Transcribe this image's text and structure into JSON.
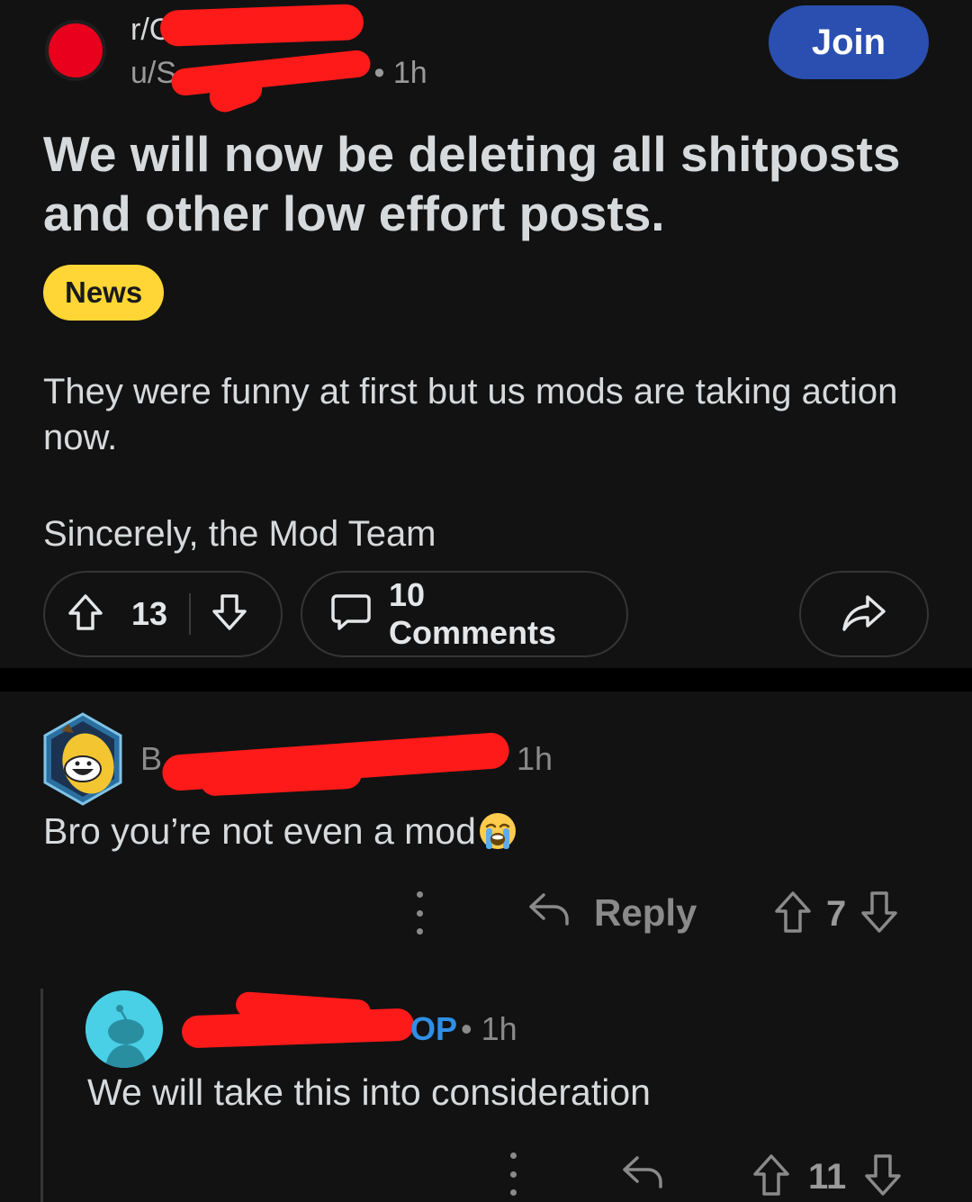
{
  "post": {
    "subreddit_prefix": "r/C",
    "user_prefix": "u/S",
    "age": "1h",
    "join_label": "Join",
    "title": "We will now be deleting all shitposts and other low effort posts.",
    "flair": "News",
    "body_paragraphs": [
      "They were funny at first but us mods are taking action now.",
      "Sincerely, the Mod Team"
    ],
    "score": "13",
    "comments_label": "10 Comments"
  },
  "comments": [
    {
      "user_prefix": "B",
      "age": "1h",
      "text": "Bro you’re not even a mod",
      "reply_label": "Reply",
      "score": "7"
    },
    {
      "op_badge": "OP",
      "age": "• 1h",
      "text": "We will take this into consideration",
      "score": "11"
    }
  ],
  "icons": {
    "upvote": "upvote-arrow-icon",
    "downvote": "downvote-arrow-icon",
    "comments": "speech-bubble-icon",
    "share": "share-arrow-icon",
    "reply": "reply-arrow-icon",
    "more": "vertical-ellipsis-icon",
    "loudly_crying": "loudly-crying-face-emoji"
  },
  "colors": {
    "background": "#121212",
    "join_button": "#2a4fb0",
    "flair": "#ffd635",
    "op_badge": "#2f8fe5",
    "redaction": "#ff1a1a"
  }
}
